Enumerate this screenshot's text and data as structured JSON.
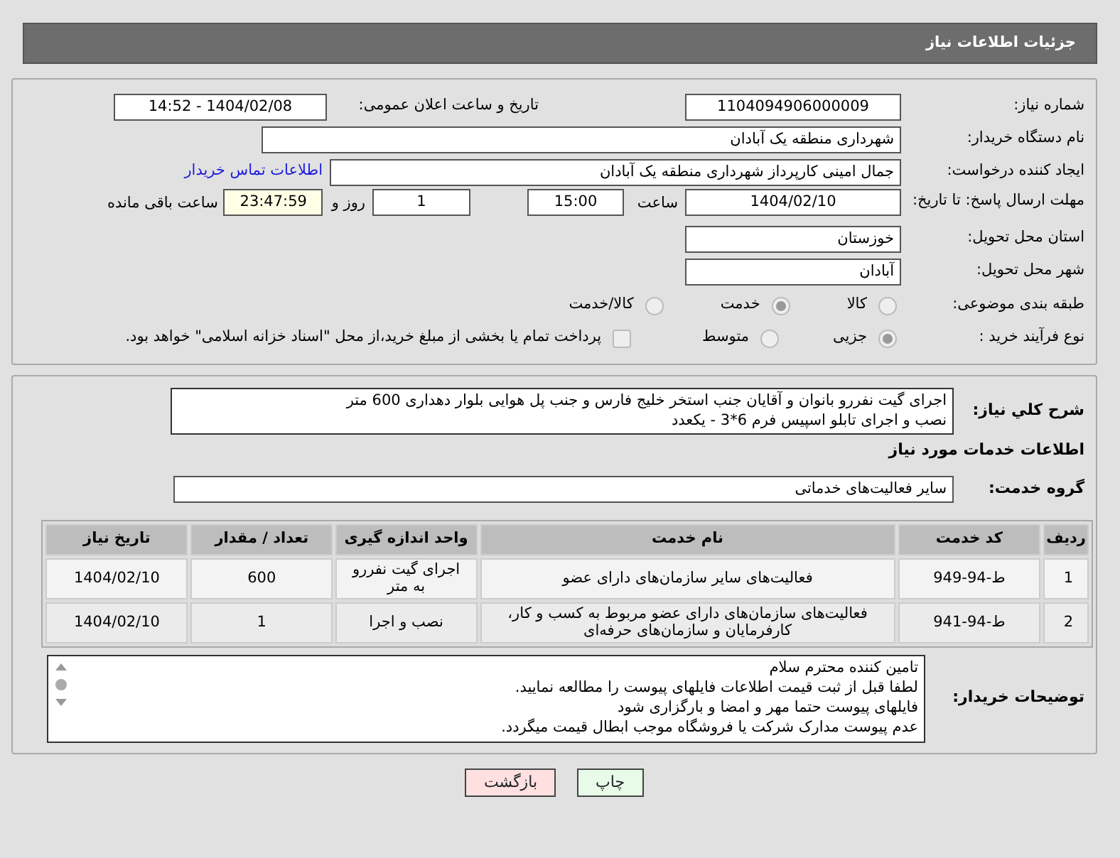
{
  "header": {
    "title": "جزئیات اطلاعات نیاز"
  },
  "need_number": {
    "label": "شماره نیاز:",
    "value": "1104094906000009"
  },
  "announce": {
    "label": "تاریخ و ساعت اعلان عمومی:",
    "value": "1404/02/08 - 14:52"
  },
  "buyer": {
    "label": "نام دستگاه خریدار:",
    "value": "شهرداری منطقه یک آبادان"
  },
  "creator": {
    "label": "ایجاد کننده درخواست:",
    "value": "جمال امینی کارپرداز شهرداری منطقه یک آبادان",
    "link": "اطلاعات تماس خریدار"
  },
  "deadline": {
    "label": "مهلت ارسال پاسخ: تا تاریخ:",
    "date": "1404/02/10",
    "time_label": "ساعت",
    "time": "15:00",
    "days": "1",
    "days_label": "روز و",
    "remaining": "23:47:59",
    "remaining_label": "ساعت باقی مانده"
  },
  "province": {
    "label": "استان محل تحویل:",
    "value": "خوزستان"
  },
  "city": {
    "label": "شهر محل تحویل:",
    "value": "آبادان"
  },
  "category": {
    "label": "طبقه بندی موضوعی:",
    "options": [
      {
        "label": "کالا",
        "selected": false
      },
      {
        "label": "خدمت",
        "selected": true
      },
      {
        "label": "کالا/خدمت",
        "selected": false
      }
    ]
  },
  "process": {
    "label": "نوع فرآیند خرید :",
    "options": [
      {
        "label": "جزیی",
        "selected": true
      },
      {
        "label": "متوسط",
        "selected": false
      }
    ],
    "payment": {
      "label": "پرداخت تمام یا بخشی از مبلغ خرید،از محل \"اسناد خزانه اسلامی\" خواهد بود.",
      "checked": false
    }
  },
  "description": {
    "label": "شرح کلي نياز:",
    "lines": [
      "اجرای گیت نفررو بانوان و آقایان جنب استخر خلیج فارس و جنب پل هوایی بلوار دهداری 600 متر",
      "نصب و اجرای تابلو اسپیس فرم 6*3 - یکعدد"
    ]
  },
  "services_title": "اطلاعات خدمات مورد نياز",
  "service_group": {
    "label": "گروه خدمت:",
    "value": "سایر فعالیت‌های خدماتی"
  },
  "table": {
    "columns": [
      "ردیف",
      "کد خدمت",
      "نام خدمت",
      "واحد اندازه گیری",
      "تعداد / مقدار",
      "تاریخ نیاز"
    ],
    "rows": [
      [
        "1",
        "ط-94-949",
        "فعالیت‌های سایر سازمان‌های دارای عضو",
        "اجرای گیت نفررو به متر",
        "600",
        "1404/02/10"
      ],
      [
        "2",
        "ط-94-941",
        "فعالیت‌های سازمان‌های دارای عضو مربوط به کسب و کار، کارفرمایان و سازمان‌های حرفه‌ای",
        "نصب و اجرا",
        "1",
        "1404/02/10"
      ]
    ]
  },
  "notes": {
    "label": "توضیحات خریدار:",
    "lines": [
      "تامین کننده محترم سلام",
      "لطفا قبل از ثبت قیمت اطلاعات فایلهای پیوست را مطالعه نمایید.",
      "فایلهای پیوست حتما مهر و امضا و بارگزاری شود",
      "عدم پیوست مدارک شرکت یا فروشگاه موجب ابطال قیمت میگردد."
    ]
  },
  "buttons": [
    {
      "label": "چاپ",
      "kind": "print"
    },
    {
      "label": "بازگشت",
      "kind": "back"
    }
  ]
}
